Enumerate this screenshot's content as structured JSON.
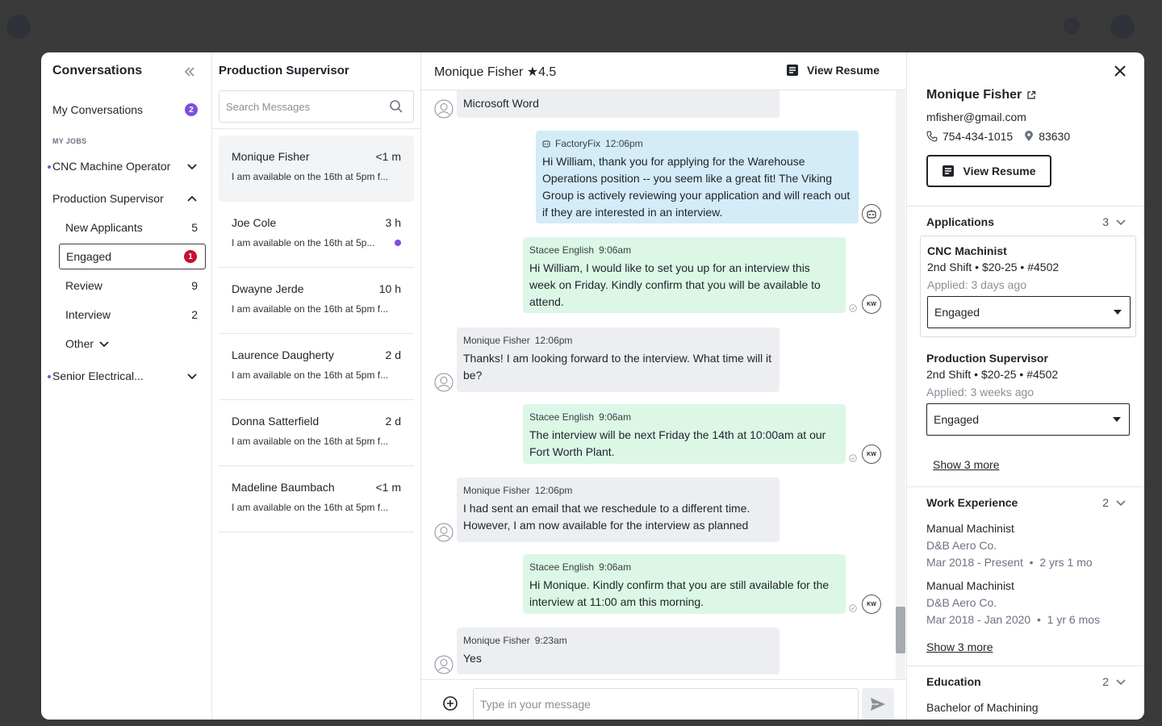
{
  "nav": {
    "title": "Conversations",
    "my_conversations": {
      "label": "My Conversations",
      "count": "2"
    },
    "section_label": "MY JOBS",
    "jobs": [
      {
        "label": "CNC Machine Operator"
      },
      {
        "label": "Production Supervisor"
      },
      {
        "label": "Senior Electrical..."
      }
    ],
    "stages": [
      {
        "label": "New Applicants",
        "count": "5"
      },
      {
        "label": "Engaged",
        "count": "1"
      },
      {
        "label": "Review",
        "count": "9"
      },
      {
        "label": "Interview",
        "count": "2"
      },
      {
        "label": "Other"
      }
    ]
  },
  "convlist": {
    "title": "Production Supervisor",
    "search_placeholder": "Search Messages",
    "items": [
      {
        "name": "Monique Fisher",
        "time": "<1 m",
        "snippet": "I am available on the 16th at 5pm f..."
      },
      {
        "name": "Joe Cole",
        "time": "3 h",
        "snippet": "I am available on the 16th at 5p..."
      },
      {
        "name": "Dwayne Jerde",
        "time": "10 h",
        "snippet": "I am available on the 16th at 5pm f..."
      },
      {
        "name": "Laurence Daugherty",
        "time": "2 d",
        "snippet": "I am available on the 16th at 5pm f..."
      },
      {
        "name": "Donna Satterfield",
        "time": "2 d",
        "snippet": "I am available on the 16th at 5pm f..."
      },
      {
        "name": "Madeline Baumbach",
        "time": "<1 m",
        "snippet": "I am available on the 16th at 5pm f..."
      }
    ]
  },
  "chat": {
    "name": "Monique Fisher",
    "rating": "★4.5",
    "view_resume": "View Resume",
    "messages": [
      {
        "sender": "",
        "time": "",
        "text": "Microsoft Word"
      },
      {
        "sender": "FactoryFix",
        "time": "12:06pm",
        "text": "Hi William, thank you for applying for the Warehouse Operations position -- you seem like a great fit! The Viking Group is actively reviewing your application and will reach out if they are interested in an interview."
      },
      {
        "sender": "Stacee English",
        "time": "9:06am",
        "text": "Hi William, I would like to set you up for an interview this week on Friday. Kindly confirm that you will be available to attend."
      },
      {
        "sender": "Monique Fisher",
        "time": "12:06pm",
        "text": "Thanks! I am looking forward to the interview. What time will it be?"
      },
      {
        "sender": "Stacee English",
        "time": "9:06am",
        "text": "The interview will be next  Friday the 14th at 10:00am at our Fort Worth Plant."
      },
      {
        "sender": "Monique Fisher",
        "time": "12:06pm",
        "text": "I had sent an email that we reschedule to a different time. However, I am now available for the interview as planned"
      },
      {
        "sender": "Stacee English",
        "time": "9:06am",
        "text": "Hi Monique. Kindly confirm that you are still available for the interview at 11:00 am this morning."
      },
      {
        "sender": "Monique Fisher",
        "time": "9:23am",
        "text": "Yes"
      }
    ],
    "initials": "KW",
    "composer_placeholder": "Type in your message"
  },
  "profile": {
    "name": "Monique Fisher",
    "email": "mfisher@gmail.com",
    "phone": "754-434-1015",
    "zip": "83630",
    "view_resume": "View Resume",
    "applications": {
      "title": "Applications",
      "count": "3",
      "items": [
        {
          "title": "CNC Machinist",
          "detail": "2nd Shift • $20-25 • #4502",
          "applied": "Applied: 3 days ago",
          "status": "Engaged"
        },
        {
          "title": "Production Supervisor",
          "detail": "2nd Shift • $20-25 • #4502",
          "applied": "Applied: 3 weeks ago",
          "status": "Engaged"
        }
      ],
      "show_more": "Show 3 more"
    },
    "work": {
      "title": "Work Experience",
      "count": "2",
      "items": [
        {
          "role": "Manual Machinist",
          "company": "D&B Aero Co.",
          "dates": "Mar 2018 - Present",
          "duration": "2 yrs 1 mo"
        },
        {
          "role": "Manual Machinist",
          "company": "D&B Aero Co.",
          "dates": "Mar 2018 - Jan 2020",
          "duration": "1 yr 6 mos"
        }
      ],
      "show_more": "Show 3 more"
    },
    "education": {
      "title": "Education",
      "count": "2",
      "first": "Bachelor of Machining"
    }
  },
  "colors": {
    "accent": "#7b4fe0",
    "alert": "#c8102e",
    "bot_bubble": "#d3ecf8",
    "out_bubble": "#dcf7e6",
    "in_bubble": "#eceef1"
  }
}
